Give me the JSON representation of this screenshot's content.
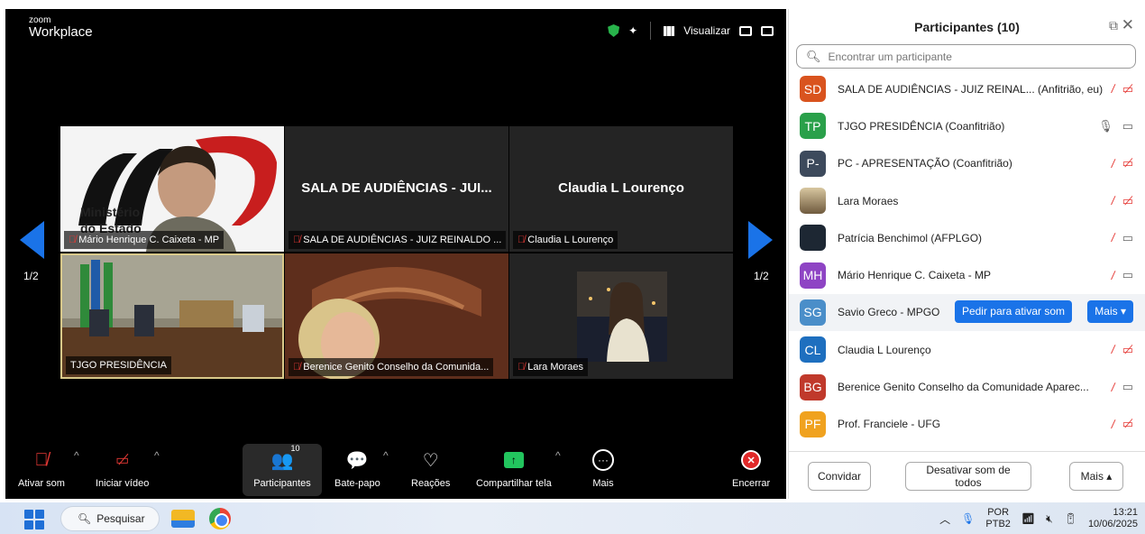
{
  "app": {
    "logo_small": "zoom",
    "logo_big": "Workplace",
    "view_label": "Visualizar",
    "page_left": "1/2",
    "page_right": "1/2"
  },
  "tiles": [
    {
      "name": "Mário Henrique C. Caixeta - MP",
      "muted": true,
      "center": ""
    },
    {
      "name": "SALA DE AUDIÊNCIAS - JUIZ REINALDO ...",
      "muted": true,
      "center": "SALA DE AUDIÊNCIAS - JUI..."
    },
    {
      "name": "Claudia L Lourenço",
      "muted": true,
      "center": "Claudia L Lourenço"
    },
    {
      "name": "TJGO PRESIDÊNCIA",
      "muted": false,
      "center": ""
    },
    {
      "name": "Berenice Genito Conselho da Comunida...",
      "muted": true,
      "center": ""
    },
    {
      "name": "Lara Moraes",
      "muted": true,
      "center": ""
    }
  ],
  "controls": {
    "mute": "Ativar som",
    "video": "Iniciar vídeo",
    "participants": "Participantes",
    "participants_count": "10",
    "chat": "Bate-papo",
    "reactions": "Reações",
    "share": "Compartilhar tela",
    "more": "Mais",
    "end": "Encerrar"
  },
  "panel": {
    "title": "Participantes (10)",
    "search_placeholder": "Encontrar um participante",
    "ask_unmute": "Pedir para ativar som",
    "row_more": "Mais ▾",
    "invite": "Convidar",
    "mute_all": "Desativar som de todos",
    "more": "Mais ▴",
    "participants": [
      {
        "initials": "SD",
        "color": "#d9531e",
        "name": "SALA DE AUDIÊNCIAS - JUIZ REINAL...  (Anfitrião, eu)",
        "mic": "off",
        "cam": "off"
      },
      {
        "initials": "TP",
        "color": "#2aa04a",
        "name": "TJGO PRESIDÊNCIA (Coanfitrião)",
        "mic": "on",
        "cam": "on"
      },
      {
        "initials": "P-",
        "color": "#3d4a5c",
        "name": "PC - APRESENTAÇÃO (Coanfitrião)",
        "mic": "off",
        "cam": "off"
      },
      {
        "initials": "",
        "color": "#b79c6e",
        "name": "Lara Moraes",
        "mic": "off",
        "cam": "off"
      },
      {
        "initials": "",
        "color": "#1d2733",
        "name": "Patrícia Benchimol (AFPLGO)",
        "mic": "off",
        "cam": "on"
      },
      {
        "initials": "MH",
        "color": "#8e44c4",
        "name": "Mário Henrique C. Caixeta - MP",
        "mic": "off",
        "cam": "on"
      },
      {
        "initials": "SG",
        "color": "#4a8ec9",
        "name": "Savio Greco - MPGO",
        "mic": "none",
        "cam": "none"
      },
      {
        "initials": "CL",
        "color": "#1e6fbf",
        "name": "Claudia L Lourenço",
        "mic": "off",
        "cam": "off"
      },
      {
        "initials": "BG",
        "color": "#c0392b",
        "name": "Berenice Genito Conselho da Comunidade Aparec...",
        "mic": "off",
        "cam": "on"
      },
      {
        "initials": "PF",
        "color": "#f0a21f",
        "name": "Prof. Franciele - UFG",
        "mic": "off",
        "cam": "off"
      }
    ]
  },
  "taskbar": {
    "search": "Pesquisar",
    "lang1": "POR",
    "lang2": "PTB2",
    "time": "13:21",
    "date": "10/06/2025"
  }
}
